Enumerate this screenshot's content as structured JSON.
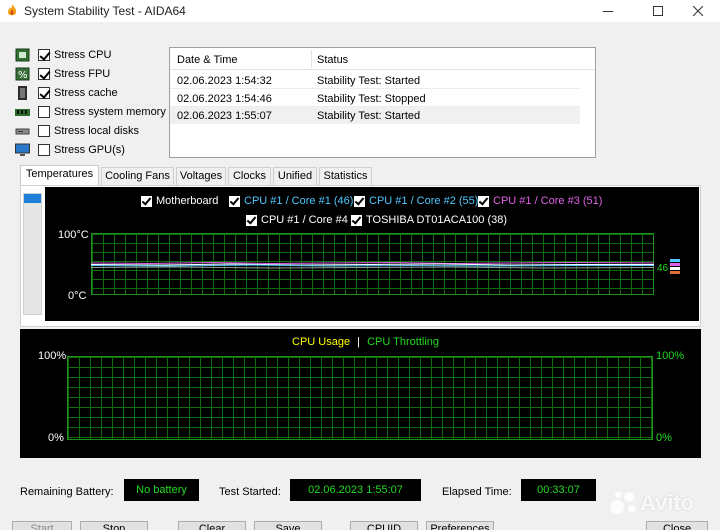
{
  "window": {
    "title": "System Stability Test - AIDA64"
  },
  "stress": [
    {
      "label": "Stress CPU",
      "checked": true,
      "icon": "cpu-chip-icon"
    },
    {
      "label": "Stress FPU",
      "checked": true,
      "icon": "fpu-percent-icon"
    },
    {
      "label": "Stress cache",
      "checked": true,
      "icon": "cache-chip-icon"
    },
    {
      "label": "Stress system memory",
      "checked": false,
      "icon": "memory-module-icon"
    },
    {
      "label": "Stress local disks",
      "checked": false,
      "icon": "hard-disk-icon"
    },
    {
      "label": "Stress GPU(s)",
      "checked": false,
      "icon": "monitor-icon"
    }
  ],
  "log": {
    "columns": [
      "Date & Time",
      "Status"
    ],
    "rows": [
      {
        "time": "02.06.2023 1:54:32",
        "status": "Stability Test: Started"
      },
      {
        "time": "02.06.2023 1:54:46",
        "status": "Stability Test: Stopped"
      },
      {
        "time": "02.06.2023 1:55:07",
        "status": "Stability Test: Started"
      }
    ]
  },
  "tabs": [
    "Temperatures",
    "Cooling Fans",
    "Voltages",
    "Clocks",
    "Unified",
    "Statistics"
  ],
  "temperature": {
    "legend": [
      {
        "label": "Motherboard",
        "color": "#ffffff"
      },
      {
        "label": "CPU #1 / Core #1 (46)",
        "color": "#4fc8ff"
      },
      {
        "label": "CPU #1 / Core #2 (55)",
        "color": "#4fc8ff"
      },
      {
        "label": "CPU #1 / Core #3 (51)",
        "color": "#e061e8"
      },
      {
        "label": "CPU #1 / Core #4",
        "color": "#ffffff"
      },
      {
        "label": "TOSHIBA DT01ACA100 (38)",
        "color": "#ffffff"
      }
    ],
    "y_max_label": "100°C",
    "y_min_label": "0°C",
    "current_value": "46"
  },
  "cpu_usage": {
    "title_usage": "CPU Usage",
    "title_sep": "|",
    "title_throttle": "CPU Throttling",
    "left_max": "100%",
    "left_min": "0%",
    "right_max": "100%",
    "right_min": "0%",
    "usage_color": "#ffff00",
    "throttle_color": "#21d821"
  },
  "status": {
    "battery_label": "Remaining Battery:",
    "battery_value": "No battery",
    "started_label": "Test Started:",
    "started_value": "02.06.2023 1:55:07",
    "elapsed_label": "Elapsed Time:",
    "elapsed_value": "00:33:07"
  },
  "buttons": {
    "start": "Start",
    "stop": "Stop",
    "clear": "Clear",
    "save": "Save",
    "cpuid": "CPUID",
    "preferences": "Preferences",
    "close": "Close"
  },
  "watermark": "Avito"
}
